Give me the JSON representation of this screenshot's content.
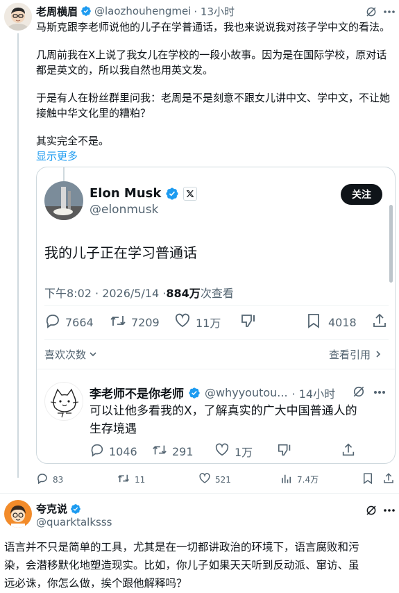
{
  "tweet": {
    "author_name": "老周横眉",
    "handle": "@laozhouhengmei",
    "time": "· 13小时",
    "paragraphs": [
      "马斯克跟李老师说他的儿子在学普通话，我也来说说我对孩子学中文的看法。",
      "几周前我在X上说了我女儿在学校的一段小故事。因为是在国际学校，原对话都是英文的，所以我自然也用英文发。",
      "于是有人在粉丝群里问我：老周是不是刻意不跟女儿讲中文、学中文，不让她接触中华文化里的糟粕？",
      "其实完全不是。"
    ],
    "show_more": "显示更多",
    "stats": {
      "replies": "83",
      "retweets": "11",
      "likes": "521",
      "views": "7.4万"
    }
  },
  "quoted": {
    "author_name": "Elon Musk",
    "handle": "@elonmusk",
    "follow_label": "关注",
    "text": "我的儿子正在学习普通话",
    "time": "下午8:02 · 2026/5/14 · ",
    "views_count": "884万",
    "views_label": " 次查看",
    "stats": {
      "replies": "7664",
      "retweets": "7209",
      "likes": "11万",
      "bookmarks": "4018"
    },
    "read_replies": "喜欢次数",
    "view_quotes": "查看引用"
  },
  "reply": {
    "author_name": "李老师不是你老师",
    "handle": "@whyyoutou...",
    "time": "· 14小时",
    "text_line1": "可以让他多看我的X，了解真实的广大中国普通人的",
    "text_line2": "生存境遇",
    "stats": {
      "replies": "1046",
      "retweets": "291",
      "likes": "1万"
    }
  },
  "tweet2": {
    "author_name": "夸克说",
    "handle": "@quarktalksss",
    "text_line1": "语言并不只是简单的工具，尤其是在一切都讲政治的环境下，语言腐败和污",
    "text_line2": "染，会潜移默化地塑造现实。比如，你儿子如果天天听到反动派、窜访、虽",
    "text_line3": "远必诛，你怎么做，挨个跟他解释吗？"
  },
  "colors": {
    "accent": "#1d9bf0",
    "text": "#0f1419",
    "muted": "#536471",
    "border": "#cfd9de"
  }
}
